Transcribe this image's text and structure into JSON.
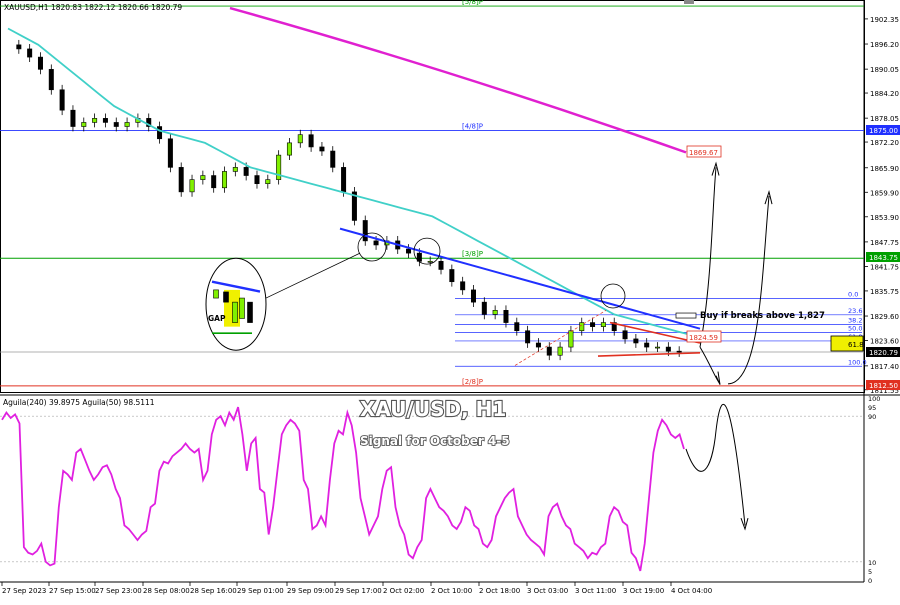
{
  "chart_data": [
    {
      "type": "candlestick",
      "symbol_header": "XAUUSD,H1  1820.83 1822.12 1820.66 1820.79",
      "title": "XAU/USD, H1",
      "subtitle": "Signal for October 4-5",
      "ylim": [
        1811,
        1906
      ],
      "yticks": [
        "1902.35",
        "1896.20",
        "1890.05",
        "1884.20",
        "1878.05",
        "1872.20",
        "1865.90",
        "1859.90",
        "1853.90",
        "1847.75",
        "1841.75",
        "1835.75",
        "1829.60",
        "1823.60",
        "1817.40",
        "1811.55"
      ],
      "xticks": [
        "27 Sep 2023",
        "27 Sep 15:00",
        "27 Sep 23:00",
        "28 Sep 08:00",
        "28 Sep 16:00",
        "29 Sep 01:00",
        "29 Sep 09:00",
        "29 Sep 17:00",
        "2 Oct 02:00",
        "2 Oct 10:00",
        "2 Oct 18:00",
        "3 Oct 03:00",
        "3 Oct 11:00",
        "3 Oct 19:00",
        "4 Oct 04:00"
      ],
      "close_path": [
        1896,
        1895,
        1893,
        1890,
        1885,
        1880,
        1876,
        1877,
        1878,
        1877,
        1876,
        1877,
        1878,
        1876,
        1873,
        1866,
        1860,
        1863,
        1864,
        1861,
        1865,
        1866,
        1864,
        1862,
        1863,
        1869,
        1872,
        1874,
        1871,
        1870,
        1866,
        1860,
        1853,
        1848,
        1847,
        1848,
        1846,
        1845,
        1843,
        1843,
        1841,
        1838,
        1836,
        1833,
        1830,
        1831,
        1828,
        1826,
        1823,
        1822,
        1820,
        1822,
        1826,
        1828,
        1827,
        1828,
        1826,
        1824,
        1823,
        1822,
        1822,
        1821,
        1820.79
      ],
      "series": [
        {
          "name": "",
          "color": "#40d0c8",
          "values": [
            1900,
            1898,
            1896,
            1893,
            1890,
            1887,
            1884,
            1881,
            1879,
            1877,
            1875,
            1874,
            1873,
            1872,
            1870,
            1868,
            1866,
            1865,
            1864,
            1863,
            1862,
            1861,
            1860,
            1859,
            1858,
            1857,
            1856,
            1855,
            1854,
            1852,
            1850,
            1848,
            1846,
            1844,
            1842,
            1840,
            1838,
            1836,
            1834,
            1832,
            1830,
            1829,
            1828,
            1827,
            1826,
            1825
          ]
        },
        {
          "name": "",
          "color": "#e020d0",
          "start": 1905,
          "end": 1869.67
        }
      ],
      "price_labels": {
        "current": "1820.79",
        "h48": "1875.00",
        "ma200": "1869.67",
        "green_level": "1843.75",
        "target_ret": "1824.59",
        "fib_618": "61.8",
        "h28": "1812.50"
      },
      "murrey_levels": [
        {
          "label": "[5/8]P",
          "price": 1905.5,
          "color": "#00a000"
        },
        {
          "label": "[4/8]P",
          "price": 1875.0,
          "color": "#2030ff"
        },
        {
          "label": "[3/8]P",
          "price": 1843.75,
          "color": "#00a000"
        },
        {
          "label": "[2/8]P",
          "price": 1812.5,
          "color": "#e03020"
        }
      ],
      "fib_levels": [
        {
          "label": "0.0",
          "price": 1833.9
        },
        {
          "label": "23.6",
          "price": 1829.9
        },
        {
          "label": "38.2",
          "price": 1827.5
        },
        {
          "label": "50.0",
          "price": 1825.6
        },
        {
          "label": "61.8",
          "price": 1823.5
        },
        {
          "label": "100.0",
          "price": 1817.3
        }
      ],
      "annotations": {
        "gap": "GAP",
        "buy": "Buy if breaks above 1,827"
      }
    },
    {
      "type": "line",
      "header": "Aguila(240) 39.8975  Aguila(50) 98.5111",
      "ylim": [
        0,
        100
      ],
      "ticks_top": [
        "100",
        "95",
        "90"
      ],
      "ticks_bottom": [
        "10",
        "5",
        "0"
      ],
      "color": "#e020e0",
      "values": [
        88,
        92,
        89,
        91,
        86,
        18,
        15,
        14,
        16,
        20,
        10,
        8,
        9,
        40,
        60,
        58,
        55,
        70,
        72,
        66,
        60,
        55,
        58,
        62,
        63,
        58,
        50,
        45,
        30,
        28,
        25,
        22,
        25,
        27,
        40,
        42,
        60,
        65,
        64,
        68,
        70,
        72,
        75,
        72,
        70,
        72,
        55,
        60,
        80,
        88,
        90,
        85,
        92,
        88,
        95,
        80,
        60,
        75,
        78,
        50,
        48,
        25,
        40,
        60,
        80,
        85,
        88,
        86,
        82,
        55,
        50,
        28,
        30,
        35,
        30,
        55,
        75,
        82,
        80,
        92,
        85,
        70,
        45,
        35,
        25,
        30,
        35,
        50,
        60,
        62,
        40,
        30,
        25,
        14,
        12,
        18,
        22,
        45,
        50,
        45,
        40,
        38,
        35,
        30,
        28,
        32,
        40,
        38,
        30,
        28,
        20,
        18,
        22,
        35,
        40,
        45,
        48,
        50,
        35,
        30,
        25,
        22,
        20,
        18,
        14,
        35,
        40,
        42,
        35,
        30,
        28,
        20,
        18,
        16,
        12,
        15,
        14,
        18,
        20,
        35,
        40,
        38,
        32,
        30,
        15,
        12,
        5,
        20,
        45,
        70,
        82,
        88,
        85,
        80,
        78,
        80,
        72
      ]
    }
  ]
}
